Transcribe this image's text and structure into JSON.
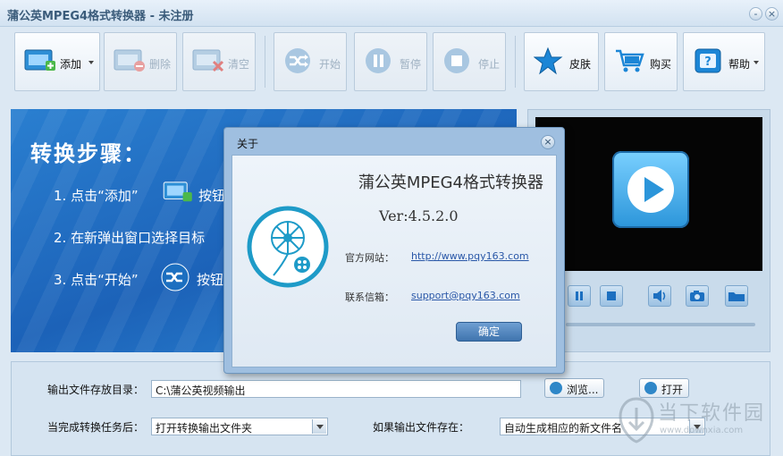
{
  "window": {
    "title": "蒲公英MPEG4格式转换器 - 未注册",
    "minimize_label": "-",
    "close_label": "×"
  },
  "toolbar": {
    "add": "添加",
    "delete": "删除",
    "clear": "清空",
    "start": "开始",
    "pause": "暂停",
    "stop": "停止",
    "skin": "皮肤",
    "buy": "购买",
    "help": "帮助"
  },
  "steps": {
    "heading": "转换步骤：",
    "step1_prefix": "1. 点击“添加”",
    "step1_suffix": "按钮",
    "step2": "2. 在新弹出窗口选择目标",
    "step3_prefix": "3. 点击“开始”",
    "step3_suffix": "按钮"
  },
  "output": {
    "dir_label": "输出文件存放目录：",
    "dir_value": "C:\\蒲公英视频输出",
    "browse_label": "浏览...",
    "open_label": "打开",
    "after_label": "当完成转换任务后：",
    "after_value": "打开转换输出文件夹",
    "exists_label": "如果输出文件存在：",
    "exists_value": "自动生成相应的新文件名"
  },
  "about_dialog": {
    "title": "关于",
    "close_label": "×",
    "app_name": "蒲公英MPEG4格式转换器",
    "version": "Ver:4.5.2.0",
    "website_label": "官方网站：",
    "website_value": "http://www.pqy163.com",
    "email_label": "联系信箱：",
    "email_value": "support@pqy163.com",
    "ok_label": "确定"
  },
  "watermark": {
    "line1": "当下软件园",
    "line2": "www.downxia.com"
  },
  "colors": {
    "accent": "#2b86d4",
    "dialog_frame": "#9fbfe0",
    "video_screen": "#050505"
  }
}
